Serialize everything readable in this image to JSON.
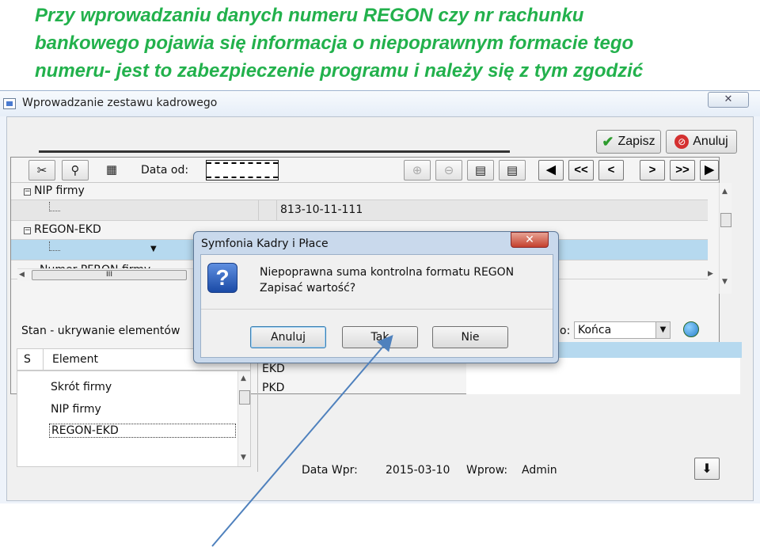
{
  "caption": {
    "line1": "Przy wprowadzaniu danych numeru REGON czy nr rachunku",
    "line2": "bankowego pojawia się informacja o niepoprawnym formacie tego",
    "line3": "numeru- jest to zabezpieczenie programu i należy się z tym zgodzić",
    "color": "#22b14c"
  },
  "window": {
    "title": "Wprowadzanie zestawu kadrowego",
    "close_glyph": "✕",
    "save_label": "Zapisz",
    "cancel_label": "Anuluj"
  },
  "toolbar": {
    "date_label": "Data od:",
    "nav": [
      "◀",
      "<<",
      "<",
      ">",
      ">>",
      "▶"
    ]
  },
  "grid": {
    "rows": [
      {
        "label": "NIP firmy",
        "value": "813-10-11-111"
      },
      {
        "label": "REGON-EKD",
        "value": ""
      },
      {
        "label": "Numer PFRON firmy",
        "value": ""
      }
    ],
    "hscroll_thumb": "III"
  },
  "elements_panel": {
    "title": "Stan - ukrywanie elementów",
    "col_s": "S",
    "col_element": "Element",
    "items": [
      "Skrót firmy",
      "NIP firmy",
      "REGON-EKD"
    ]
  },
  "right_panel": {
    "to_label": "o:",
    "to_value": "Końca",
    "list": [
      "EKD",
      "PKD"
    ]
  },
  "footer": {
    "date_label": "Data Wpr:",
    "date_value": "2015-03-10",
    "user_label": "Wprow:",
    "user_value": "Admin",
    "down_glyph": "⬇"
  },
  "dialog": {
    "title": "Symfonia Kadry i Płace",
    "close_glyph": "✕",
    "icon": "?",
    "message_line1": "Niepoprawna suma kontrolna formatu REGON",
    "message_line2": "Zapisać wartość?",
    "buttons": {
      "cancel": "Anuluj",
      "yes": "Tak",
      "no": "Nie"
    }
  },
  "colors": {
    "arrow": "#4f81bd",
    "selected_row": "#b6d9ef"
  }
}
